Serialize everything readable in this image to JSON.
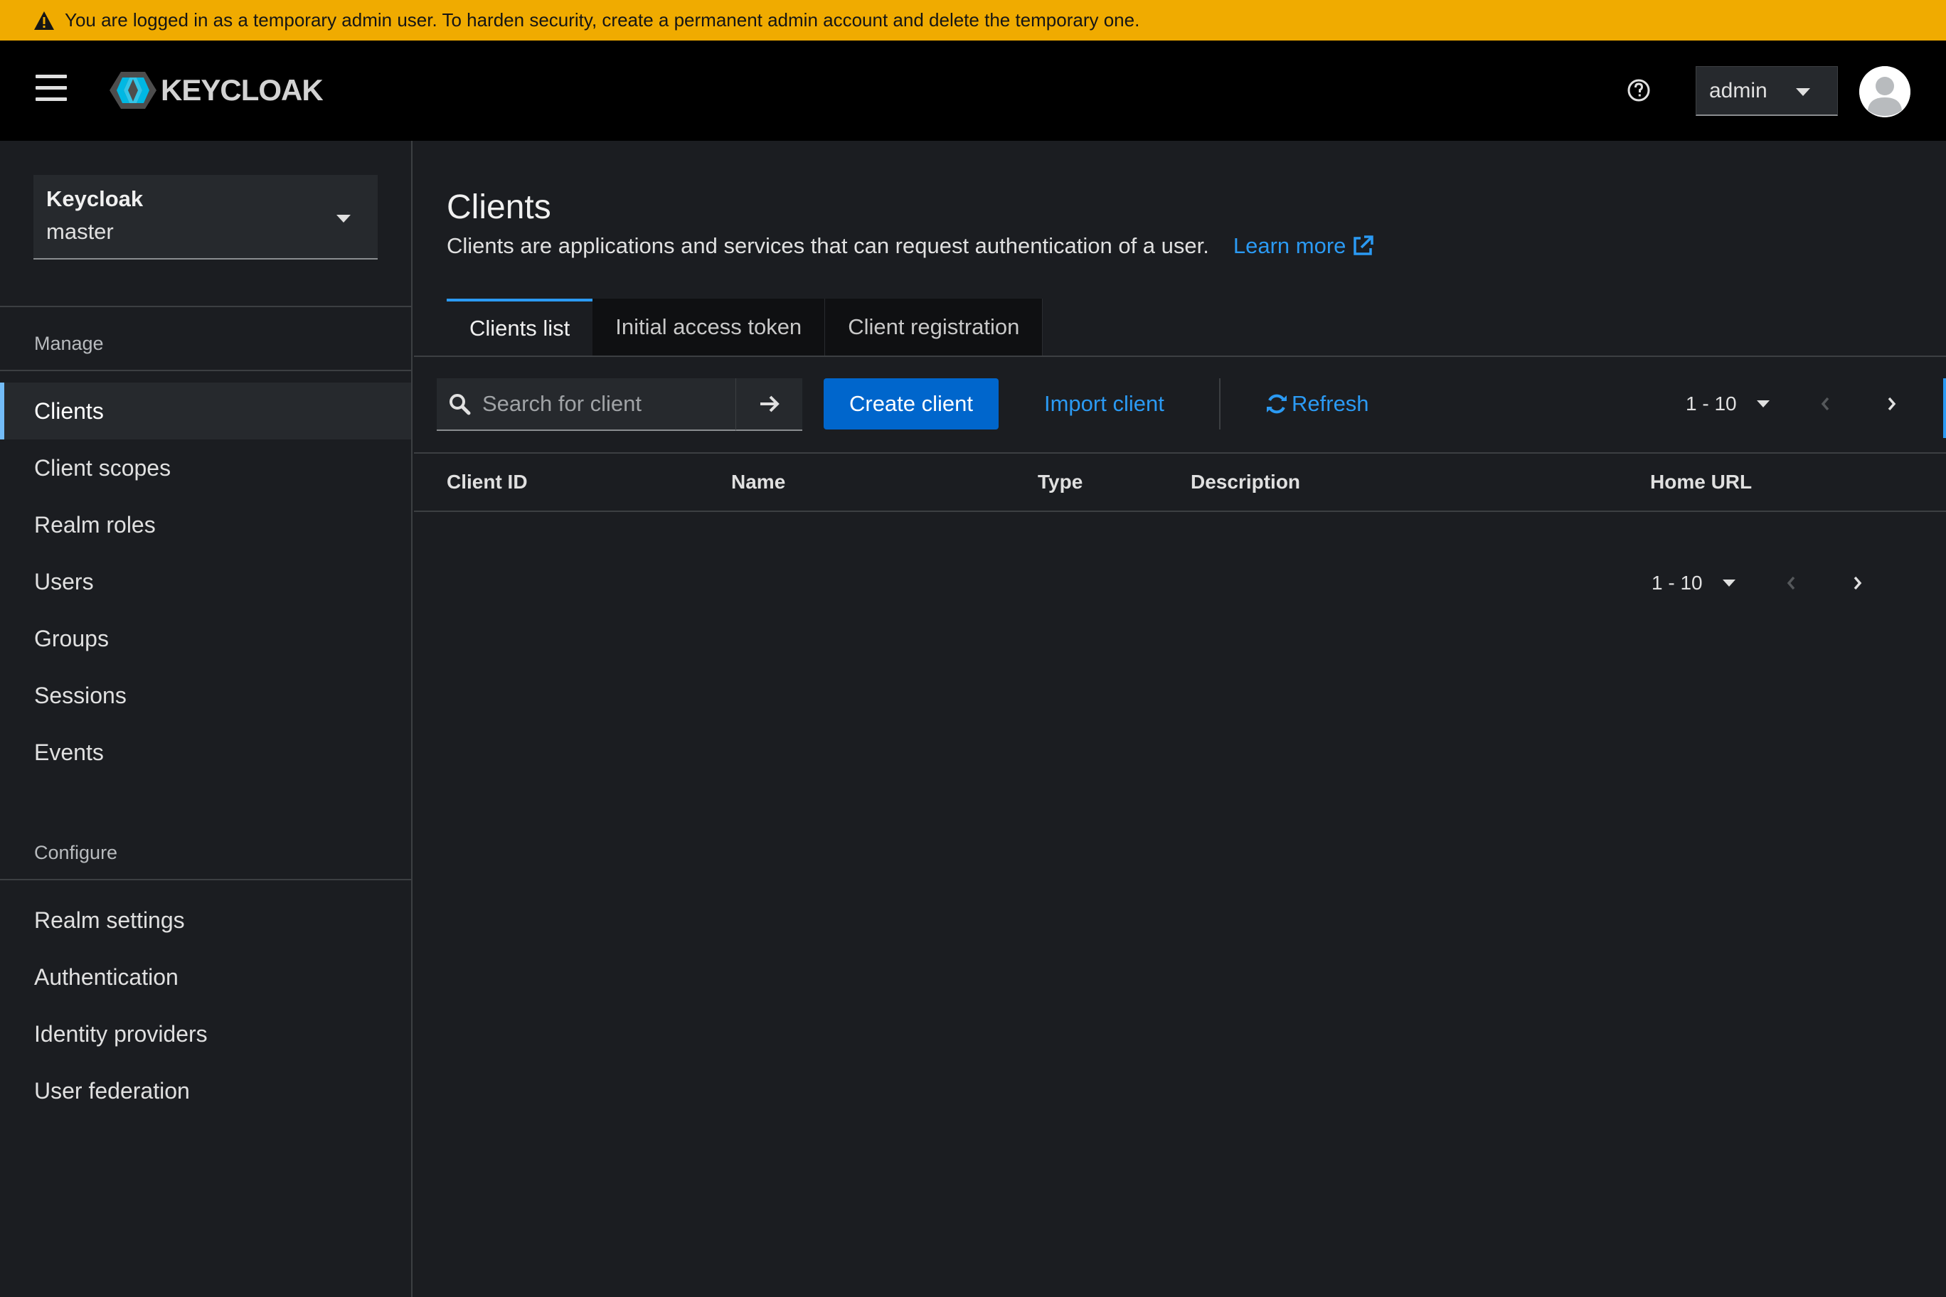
{
  "banner": {
    "text": "You are logged in as a temporary admin user. To harden security, create a permanent admin account and delete the temporary one.",
    "icon": "warning-icon"
  },
  "masthead": {
    "logo_text": "KEYCLOAK",
    "user_label": "admin",
    "icons": [
      "hamburger-icon",
      "help-icon",
      "caret-down-icon",
      "avatar-icon"
    ]
  },
  "sidebar": {
    "realm": {
      "line1": "Keycloak",
      "line2": "master"
    },
    "manage_label": "Manage",
    "manage_items": [
      {
        "label": "Clients",
        "active": true
      },
      {
        "label": "Client scopes"
      },
      {
        "label": "Realm roles"
      },
      {
        "label": "Users"
      },
      {
        "label": "Groups"
      },
      {
        "label": "Sessions"
      },
      {
        "label": "Events"
      }
    ],
    "configure_label": "Configure",
    "configure_items": [
      {
        "label": "Realm settings"
      },
      {
        "label": "Authentication"
      },
      {
        "label": "Identity providers"
      },
      {
        "label": "User federation"
      }
    ]
  },
  "main": {
    "title": "Clients",
    "description": "Clients are applications and services that can request authentication of a user.",
    "learn_more": "Learn more",
    "tabs": [
      {
        "label": "Clients list",
        "active": true
      },
      {
        "label": "Initial access token"
      },
      {
        "label": "Client registration"
      }
    ],
    "toolbar": {
      "search_placeholder": "Search for client",
      "create_label": "Create client",
      "import_label": "Import client",
      "refresh_label": "Refresh",
      "pagination": "1 - 10"
    },
    "table": {
      "columns": [
        "Client ID",
        "Name",
        "Type",
        "Description",
        "Home URL"
      ],
      "rows": []
    },
    "bottom_pagination": "1 - 10"
  },
  "colors": {
    "banner": "#f0ab00",
    "primary": "#0066cc",
    "link": "#2b9af3",
    "active_indicator": "#73bcf7",
    "background": "#1b1d21"
  }
}
